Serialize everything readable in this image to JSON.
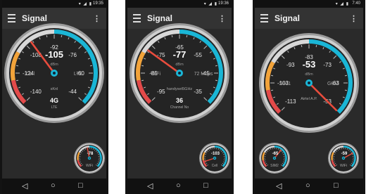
{
  "screens": [
    {
      "status_time": "19:35",
      "app_title": "Signal",
      "main": {
        "value": "-105",
        "unit": "dBm",
        "left": "Cell",
        "right": "LTE",
        "bottom": "sKnl",
        "sub_value": "4G",
        "sub_label": "LTE",
        "ticks": [
          "-140",
          "-124",
          "-108",
          "-92",
          "-76",
          "-60",
          "-44"
        ],
        "needle_value": -105
      },
      "mini": {
        "value": "-78",
        "label": "WiFi",
        "needle_value": -78
      }
    },
    {
      "status_time": "19:36",
      "app_title": "Signal",
      "main": {
        "value": "-77",
        "unit": "dBm",
        "left": "WiFi",
        "right": "72 Mbps",
        "bottom": "handyset5GHz",
        "sub_value": "36",
        "sub_label": "Channel No",
        "ticks": [
          "-95",
          "-85",
          "-75",
          "-65",
          "-55",
          "-45",
          "-35"
        ],
        "needle_value": -77
      },
      "mini": {
        "value": "-103",
        "label": "Cell",
        "needle_value": -103
      }
    },
    {
      "status_time": "7:40",
      "app_title": "Signal",
      "main": {
        "value": "-53",
        "unit": "dBm",
        "left": "SIM1",
        "right": "GSM",
        "bottom": "Airtel A.P.",
        "sub_value": "",
        "sub_label": "",
        "ticks": [
          "-113",
          "-103",
          "-93",
          "-83",
          "-73",
          "-63",
          "-53"
        ],
        "needle_value": -53
      },
      "mini_left": {
        "value": "-65",
        "label": "SIM2",
        "needle_value": -65
      },
      "mini_right": {
        "value": "-59",
        "label": "WiFi",
        "needle_value": -59
      }
    }
  ],
  "colors": {
    "accent": "#1ab6d6",
    "needle": "#e84c3d",
    "orange": "#f2a33a",
    "red": "#e34a4a",
    "bezel": "#cfcfcf"
  },
  "icons": {
    "menu": "hamburger-menu-icon",
    "overflow": "more-vert-icon",
    "back": "nav-back-icon",
    "home": "nav-home-icon",
    "recents": "nav-recents-icon"
  }
}
